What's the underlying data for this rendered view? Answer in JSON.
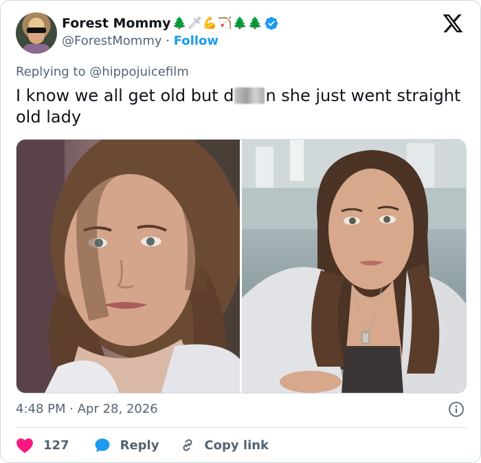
{
  "author": {
    "display_name": "Forest Mommy",
    "handle": "@ForestMommy",
    "separator": "·",
    "follow_label": "Follow",
    "emojis": [
      "🌲",
      "🗡",
      "💪",
      "🏹",
      "🌲",
      "🌲"
    ]
  },
  "reply": {
    "prefix": "Replying to",
    "target": "@hippojuicefilm"
  },
  "tweet": {
    "text_before": "I know we all get old but d",
    "text_after": "n she just went straight old lady"
  },
  "meta": {
    "time": "4:48 PM",
    "separator": "·",
    "date": "Apr 28, 2026"
  },
  "actions": {
    "likes": "127",
    "reply_label": "Reply",
    "copy_label": "Copy link"
  },
  "colors": {
    "link": "#1d9bf0",
    "like_heart": "#f91880",
    "secondary_text": "#536471",
    "primary_text": "#0f1419"
  },
  "icons": [
    "x-logo-icon",
    "verified-badge-icon",
    "info-icon",
    "heart-icon",
    "reply-bubble-icon",
    "link-icon"
  ]
}
